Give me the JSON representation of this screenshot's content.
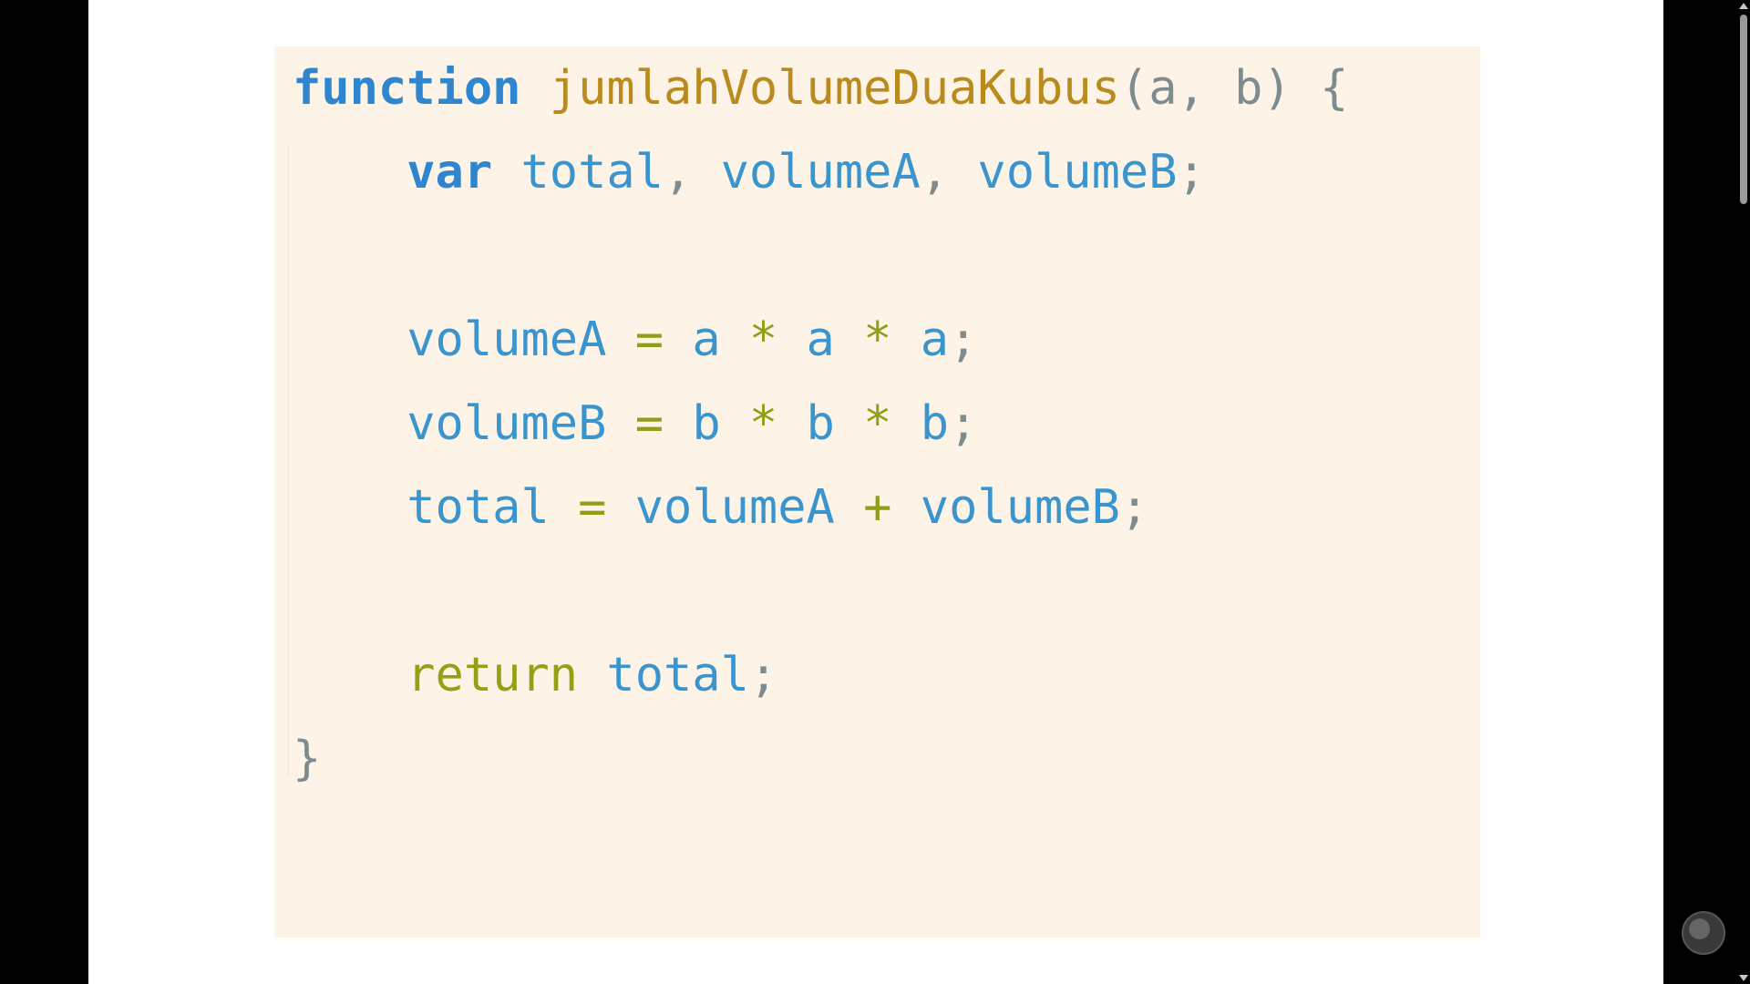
{
  "code": {
    "lines": [
      [
        {
          "text": "function",
          "cls": "kw"
        },
        {
          "text": " ",
          "cls": ""
        },
        {
          "text": "jumlahVolumeDuaKubus",
          "cls": "fn"
        },
        {
          "text": "(",
          "cls": "punct"
        },
        {
          "text": "a",
          "cls": "punct"
        },
        {
          "text": ", ",
          "cls": "punct"
        },
        {
          "text": "b",
          "cls": "punct"
        },
        {
          "text": ")",
          "cls": "punct"
        },
        {
          "text": " {",
          "cls": "punct"
        }
      ],
      [
        {
          "text": "    ",
          "cls": ""
        },
        {
          "text": "var",
          "cls": "kw"
        },
        {
          "text": " total",
          "cls": "var"
        },
        {
          "text": ",",
          "cls": "punct"
        },
        {
          "text": " volumeA",
          "cls": "var"
        },
        {
          "text": ",",
          "cls": "punct"
        },
        {
          "text": " volumeB",
          "cls": "var"
        },
        {
          "text": ";",
          "cls": "punct"
        }
      ],
      [],
      [
        {
          "text": "    ",
          "cls": ""
        },
        {
          "text": "volumeA",
          "cls": "var"
        },
        {
          "text": " = ",
          "cls": "op"
        },
        {
          "text": "a",
          "cls": "var"
        },
        {
          "text": " * ",
          "cls": "op"
        },
        {
          "text": "a",
          "cls": "var"
        },
        {
          "text": " * ",
          "cls": "op"
        },
        {
          "text": "a",
          "cls": "var"
        },
        {
          "text": ";",
          "cls": "punct"
        }
      ],
      [
        {
          "text": "    ",
          "cls": ""
        },
        {
          "text": "volumeB",
          "cls": "var"
        },
        {
          "text": " = ",
          "cls": "op"
        },
        {
          "text": "b",
          "cls": "var"
        },
        {
          "text": " * ",
          "cls": "op"
        },
        {
          "text": "b",
          "cls": "var"
        },
        {
          "text": " * ",
          "cls": "op"
        },
        {
          "text": "b",
          "cls": "var"
        },
        {
          "text": ";",
          "cls": "punct"
        }
      ],
      [
        {
          "text": "    ",
          "cls": ""
        },
        {
          "text": "total",
          "cls": "var"
        },
        {
          "text": " = ",
          "cls": "op"
        },
        {
          "text": "volumeA",
          "cls": "var"
        },
        {
          "text": " + ",
          "cls": "op"
        },
        {
          "text": "volumeB",
          "cls": "var"
        },
        {
          "text": ";",
          "cls": "punct"
        }
      ],
      [],
      [
        {
          "text": "    ",
          "cls": ""
        },
        {
          "text": "return",
          "cls": "ret"
        },
        {
          "text": " total",
          "cls": "var"
        },
        {
          "text": ";",
          "cls": "punct"
        }
      ],
      [
        {
          "text": "}",
          "cls": "punct"
        }
      ]
    ]
  },
  "colors": {
    "panel_bg": "#fdf3e7",
    "keyword": "#2f86cf",
    "function_name": "#b98a1e",
    "identifier": "#3a95cf",
    "operator": "#8f9f16",
    "return_keyword": "#95a114",
    "punctuation": "#7f8c8d"
  },
  "icons": {
    "scroll_up": "scroll-up-arrow-icon",
    "scroll_down": "scroll-down-arrow-icon",
    "watermark": "channel-logo-icon"
  }
}
